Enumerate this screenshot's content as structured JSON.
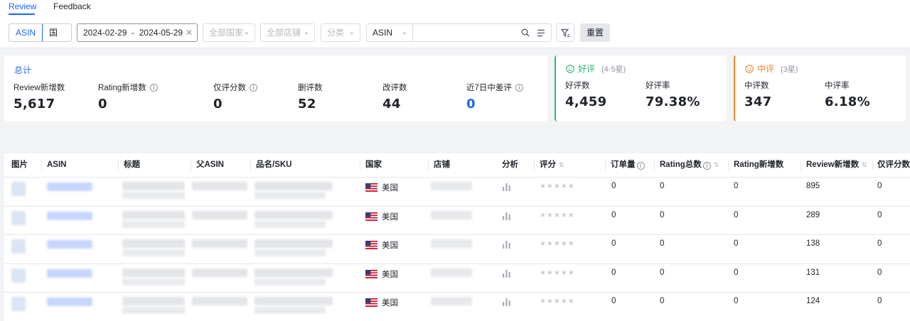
{
  "tabs": [
    {
      "label": "Review",
      "active": true
    },
    {
      "label": "Feedback",
      "active": false
    }
  ],
  "filters": {
    "segment": [
      "ASIN",
      "国家"
    ],
    "date_range": "2024-02-29  -  2024-05-29",
    "country_placeholder": "全部国家",
    "shop_placeholder": "全部店铺",
    "category_placeholder": "分类",
    "search_type": "ASIN",
    "search_value": "",
    "reset_label": "重置"
  },
  "summary": {
    "title": "总计",
    "metrics": [
      {
        "label": "Review新增数",
        "value": "5,617",
        "info": false
      },
      {
        "label": "Rating新增数",
        "value": "0",
        "info": true
      },
      {
        "label": "仅评分数",
        "value": "0",
        "info": true
      },
      {
        "label": "删评数",
        "value": "52",
        "info": false
      },
      {
        "label": "改评数",
        "value": "44",
        "info": false
      },
      {
        "label": "近7日中差评",
        "value": "0",
        "info": true,
        "highlight": true
      }
    ]
  },
  "positive": {
    "title": "好评",
    "hint": "(4-5星)",
    "count_label": "好评数",
    "count": "4,459",
    "rate_label": "好评率",
    "rate": "79.38%",
    "color": "#2bb673"
  },
  "neutral": {
    "title": "中评",
    "hint": "(3星)",
    "count_label": "中评数",
    "count": "347",
    "rate_label": "中评率",
    "rate": "6.18%",
    "color": "#f5842a"
  },
  "table": {
    "columns": [
      "图片",
      "ASIN",
      "标题",
      "父ASIN",
      "品名/SKU",
      "国家",
      "店铺",
      "分析",
      "评分",
      "订单量",
      "Rating总数",
      "Rating新增数",
      "Review新增数",
      "仅评分数"
    ],
    "rows": [
      {
        "country": "美国",
        "orders": "0",
        "rating_total": "0",
        "rating_new": "0",
        "review_new": "895",
        "rating_only": "0"
      },
      {
        "country": "美国",
        "orders": "0",
        "rating_total": "0",
        "rating_new": "0",
        "review_new": "289",
        "rating_only": "0"
      },
      {
        "country": "美国",
        "orders": "0",
        "rating_total": "0",
        "rating_new": "0",
        "review_new": "138",
        "rating_only": "0"
      },
      {
        "country": "美国",
        "orders": "0",
        "rating_total": "0",
        "rating_new": "0",
        "review_new": "131",
        "rating_only": "0"
      },
      {
        "country": "美国",
        "orders": "0",
        "rating_total": "0",
        "rating_new": "0",
        "review_new": "124",
        "rating_only": "0"
      }
    ]
  },
  "colors": {
    "accent": "#1a66ff",
    "positive": "#2bb673",
    "neutral": "#f5842a"
  }
}
